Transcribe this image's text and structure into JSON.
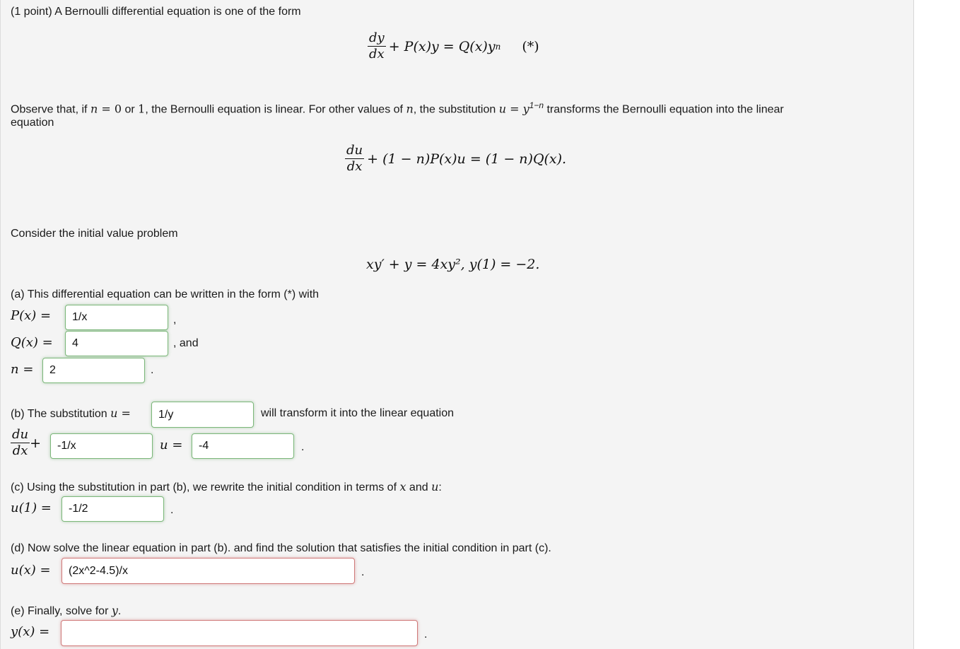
{
  "intro": {
    "heading": "(1 point) A Bernoulli differential equation is one of the form",
    "bernoulli_form": {
      "num": "dy",
      "den": "dx",
      "rest": "+ P(x)y = Q(x)y",
      "exp": "n",
      "tag": "(*)"
    },
    "observe_part1": "Observe that, if ",
    "observe_n": "n",
    "observe_eq": " = 0",
    "observe_or": " or ",
    "observe_one": "1",
    "observe_part2": ", the Bernoulli equation is linear. For other values of ",
    "observe_n2": "n",
    "observe_part3": ", the substitution ",
    "observe_sub": "u = y",
    "observe_sub_exp": "1−n",
    "observe_part4": " transforms the Bernoulli equation into the linear",
    "observe_line2": "equation",
    "linear_form": {
      "num": "du",
      "den": "dx",
      "rest": "+ (1 − n)P(x)u = (1 − n)Q(x)."
    },
    "consider": "Consider the initial value problem",
    "ivp": "xy′ + y = 4xy², y(1) = −2."
  },
  "part_a": {
    "prompt": "(a) This differential equation can be written in the form (*) with",
    "p_label": "P(x) =",
    "p_value": "1/x",
    "p_suffix": ",",
    "q_label": "Q(x) =",
    "q_value": "4",
    "q_suffix": ", and",
    "n_label": "n =",
    "n_value": "2",
    "n_suffix": "."
  },
  "part_b": {
    "prompt": "(b) The substitution ",
    "u_label": "u =",
    "u_value": "1/y",
    "prompt_after": "will transform it into the linear equation",
    "frac_num": "du",
    "frac_den": "dx",
    "plus": "+",
    "coef_value": "-1/x",
    "u_eq_label": "u =",
    "rhs_value": "-4",
    "suffix": "."
  },
  "part_c": {
    "prompt": "(c) Using the substitution in part (b), we rewrite the initial condition in terms of ",
    "var_x": "x",
    "and": " and ",
    "var_u": "u",
    "colon": ":",
    "label": "u(1) =",
    "value": "-1/2",
    "suffix": "."
  },
  "part_d": {
    "prompt": "(d) Now solve the linear equation in part (b). and find the solution that satisfies the initial condition in part (c).",
    "label": "u(x) =",
    "value": "(2x^2-4.5)/x",
    "suffix": "."
  },
  "part_e": {
    "prompt": "(e) Finally, solve for ",
    "var_y": "y",
    "period": ".",
    "label": "y(x) =",
    "value": "",
    "suffix": "."
  },
  "colors": {
    "correct_border": "#7cb77a",
    "incorrect_border": "#d07a7a",
    "panel_bg": "#f4f4f4"
  }
}
